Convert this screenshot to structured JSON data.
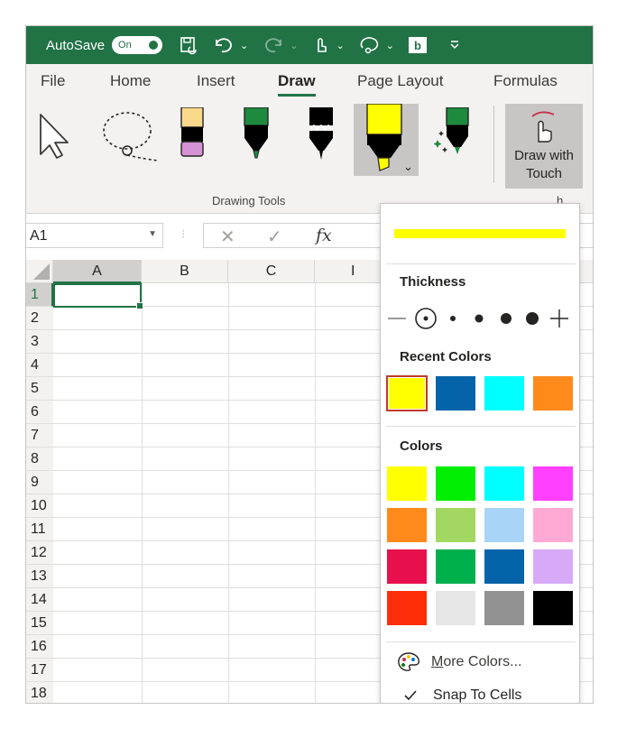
{
  "titlebar": {
    "autosave_label": "AutoSave",
    "toggle_label": "On",
    "color": "#217346"
  },
  "tabs": [
    {
      "label": "File"
    },
    {
      "label": "Home"
    },
    {
      "label": "Insert"
    },
    {
      "label": "Draw",
      "active": true
    },
    {
      "label": "Page Layout"
    },
    {
      "label": "Formulas"
    }
  ],
  "ribbon": {
    "group_label": "Drawing Tools",
    "group_label_2": "h",
    "touch_label_1": "Draw with",
    "touch_label_2": "Touch"
  },
  "formula": {
    "name_box": "A1",
    "fx": "fx",
    "cancel": "✕",
    "enter": "✓"
  },
  "grid": {
    "columns": [
      "A",
      "B",
      "C",
      "I"
    ],
    "rows": [
      "1",
      "2",
      "3",
      "4",
      "5",
      "6",
      "7",
      "8",
      "9",
      "10",
      "11",
      "12",
      "13",
      "14",
      "15",
      "16",
      "17",
      "18"
    ],
    "active_cell": "A1"
  },
  "dropdown": {
    "current_color": "#ffff00",
    "thickness_title": "Thickness",
    "recent_title": "Recent Colors",
    "colors_title": "Colors",
    "recent_colors": [
      "#ffff00",
      "#0563a9",
      "#00ffff",
      "#ff8a1c"
    ],
    "colors": [
      [
        "#ffff00",
        "#00ee00",
        "#00ffff",
        "#ff40ff"
      ],
      [
        "#ff8a1c",
        "#a2d761",
        "#a8d4f8",
        "#ffa9d4"
      ],
      [
        "#e8104c",
        "#00b04c",
        "#0563a9",
        "#d7aaf8"
      ],
      [
        "#ff2e0a",
        "#e6e6e6",
        "#929292",
        "#000000"
      ]
    ],
    "more_colors_u": "M",
    "more_colors_rest": "ore Colors...",
    "snap_label": "Snap To Cells"
  }
}
